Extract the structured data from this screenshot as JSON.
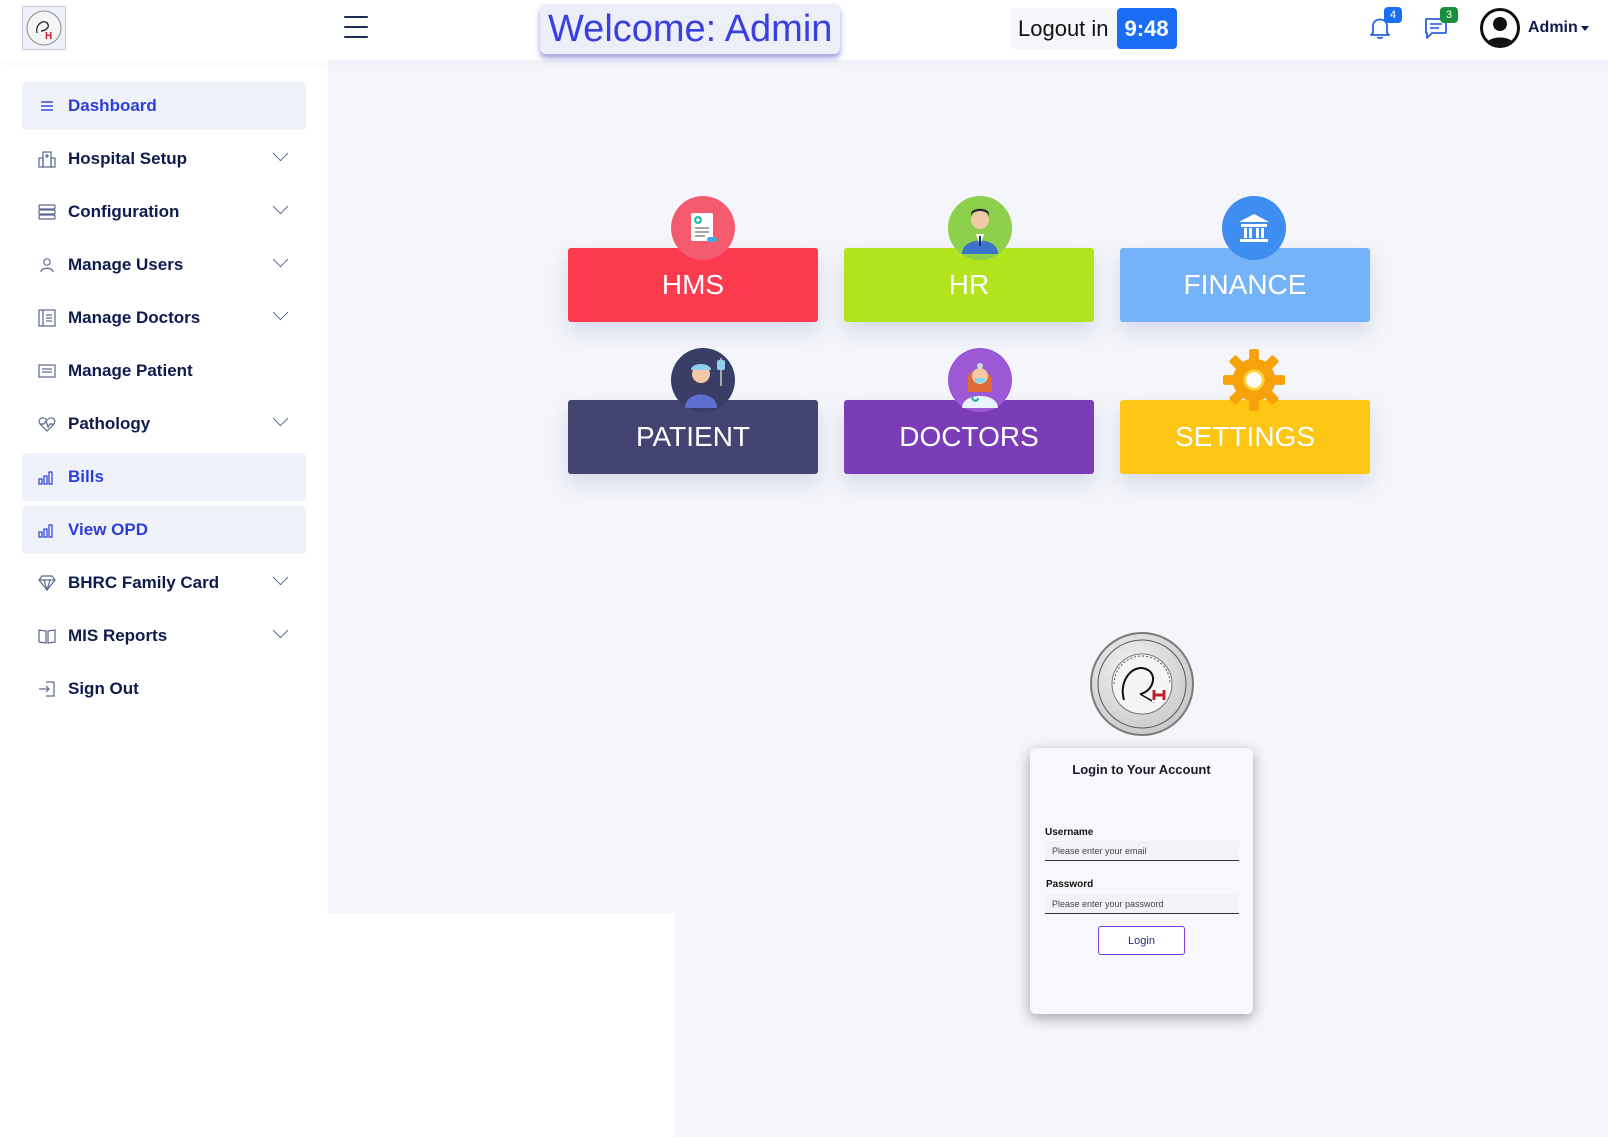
{
  "header": {
    "welcome_text": "Welcome: Admin",
    "logout_label": "Logout in",
    "logout_time": "9:48",
    "notifications_count": "4",
    "messages_count": "3",
    "user_name": "Admin"
  },
  "sidebar": {
    "items": [
      {
        "label": "Dashboard",
        "icon": "list-icon"
      },
      {
        "label": "Hospital Setup",
        "icon": "building-icon"
      },
      {
        "label": "Configuration",
        "icon": "server-icon"
      },
      {
        "label": "Manage Users",
        "icon": "user-icon"
      },
      {
        "label": "Manage Doctors",
        "icon": "document-icon"
      },
      {
        "label": "Manage Patient",
        "icon": "card-icon"
      },
      {
        "label": "Pathology",
        "icon": "heartbeat-icon"
      },
      {
        "label": "Bills",
        "icon": "bar-chart-icon"
      },
      {
        "label": "View OPD",
        "icon": "bar-chart-icon"
      },
      {
        "label": "BHRC Family Card",
        "icon": "diamond-icon"
      },
      {
        "label": "MIS Reports",
        "icon": "book-icon"
      },
      {
        "label": "Sign Out",
        "icon": "sign-out-icon"
      }
    ]
  },
  "tiles": {
    "hms": "HMS",
    "hr": "HR",
    "finance": "FINANCE",
    "patient": "PATIENT",
    "doctors": "DOCTORS",
    "settings": "SETTINGS"
  },
  "login": {
    "title": "Login to Your Account",
    "username_label": "Username",
    "username_placeholder": "Please enter your email",
    "password_label": "Password",
    "password_placeholder": "Please enter your password",
    "button_label": "Login"
  },
  "colors": {
    "accent": "#2c3ed6",
    "hms": "#fc3b4f",
    "hr": "#b2e41d",
    "finance": "#74b3f8",
    "patient": "#444473",
    "doctors": "#7b3cb8",
    "settings": "#fdc514"
  }
}
